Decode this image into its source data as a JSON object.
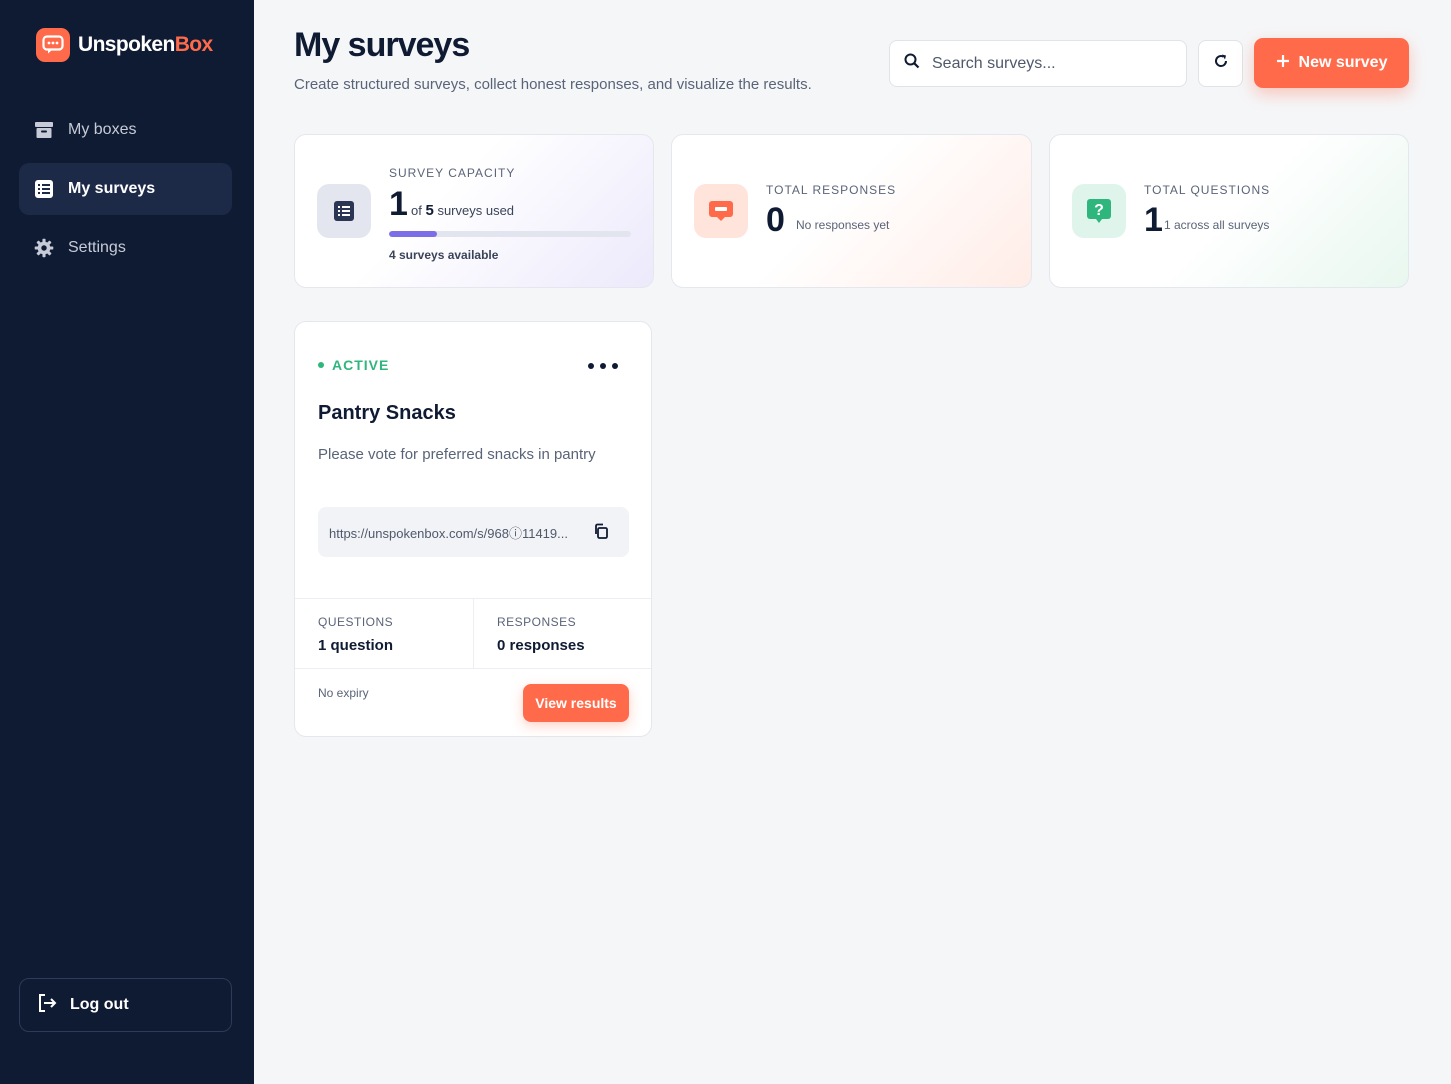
{
  "brand": {
    "name_primary": "Unspoken",
    "name_accent": "Box"
  },
  "sidebar": {
    "items": [
      {
        "label": "My boxes",
        "icon": "archive-icon",
        "active": false
      },
      {
        "label": "My surveys",
        "icon": "list-icon",
        "active": true
      },
      {
        "label": "Settings",
        "icon": "gear-icon",
        "active": false
      }
    ],
    "logout_label": "Log out"
  },
  "header": {
    "title": "My surveys",
    "subtitle": "Create structured surveys, collect honest responses, and visualize the results.",
    "search_placeholder": "Search surveys...",
    "new_survey_label": "New survey"
  },
  "stats": {
    "capacity": {
      "label": "SURVEY CAPACITY",
      "value": "1",
      "of_prefix": "of",
      "total": "5",
      "suffix": "surveys used",
      "available": "4 surveys available",
      "progress_fraction": 0.2
    },
    "responses": {
      "label": "TOTAL RESPONSES",
      "value": "0",
      "note": "No responses yet"
    },
    "questions": {
      "label": "TOTAL QUESTIONS",
      "value": "1",
      "note": "1 across all surveys"
    }
  },
  "survey": {
    "status": "ACTIVE",
    "title": "Pantry Snacks",
    "description": "Please vote for preferred snacks in pantry",
    "link": "https://unspokenbox.com/s/968ⓘ11419...",
    "questions_label": "QUESTIONS",
    "questions_value": "1 question",
    "responses_label": "RESPONSES",
    "responses_value": "0 responses",
    "expiry": "No expiry",
    "view_results_label": "View results"
  },
  "colors": {
    "sidebar_bg": "#0f1a33",
    "accent": "#ff6b4a",
    "active_green": "#2fb67d",
    "progress": "#7c6ee6"
  }
}
